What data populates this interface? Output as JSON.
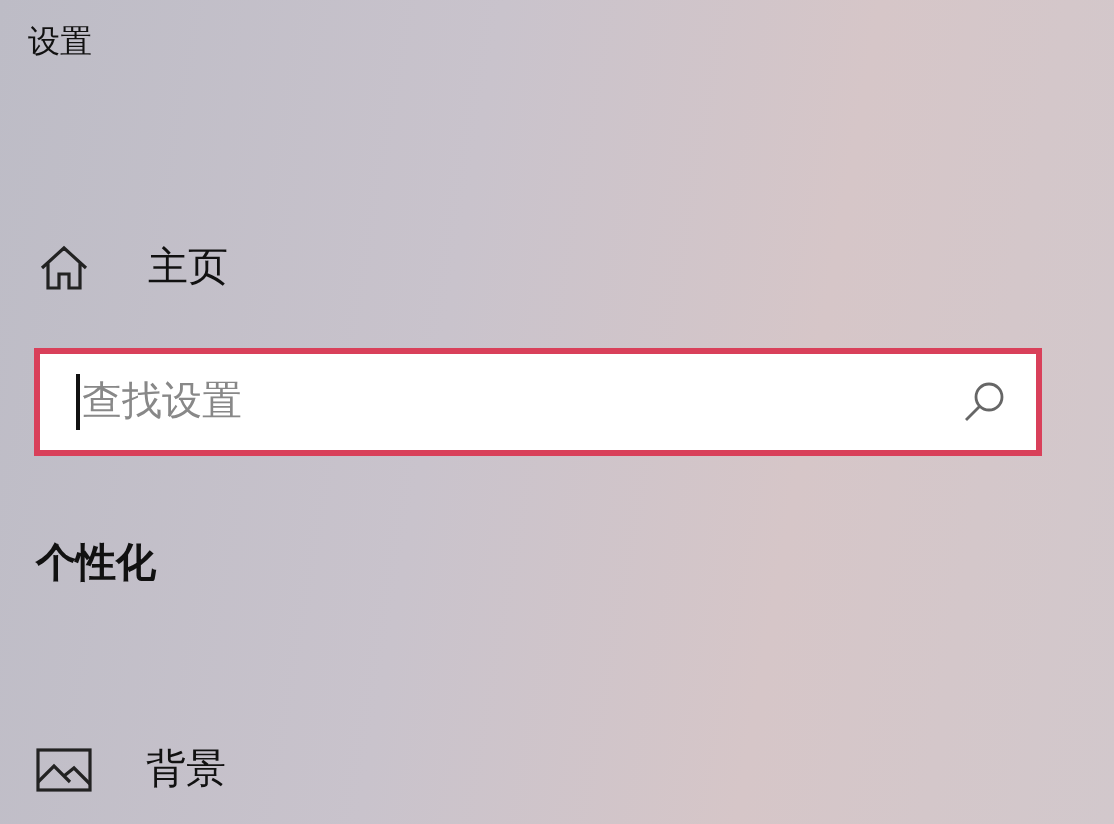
{
  "window": {
    "title": "设置"
  },
  "home": {
    "label": "主页"
  },
  "search": {
    "placeholder": "查找设置",
    "focused": true
  },
  "section": {
    "title": "个性化"
  },
  "nav_items": [
    {
      "label": "背景",
      "kind": "picture"
    }
  ]
}
